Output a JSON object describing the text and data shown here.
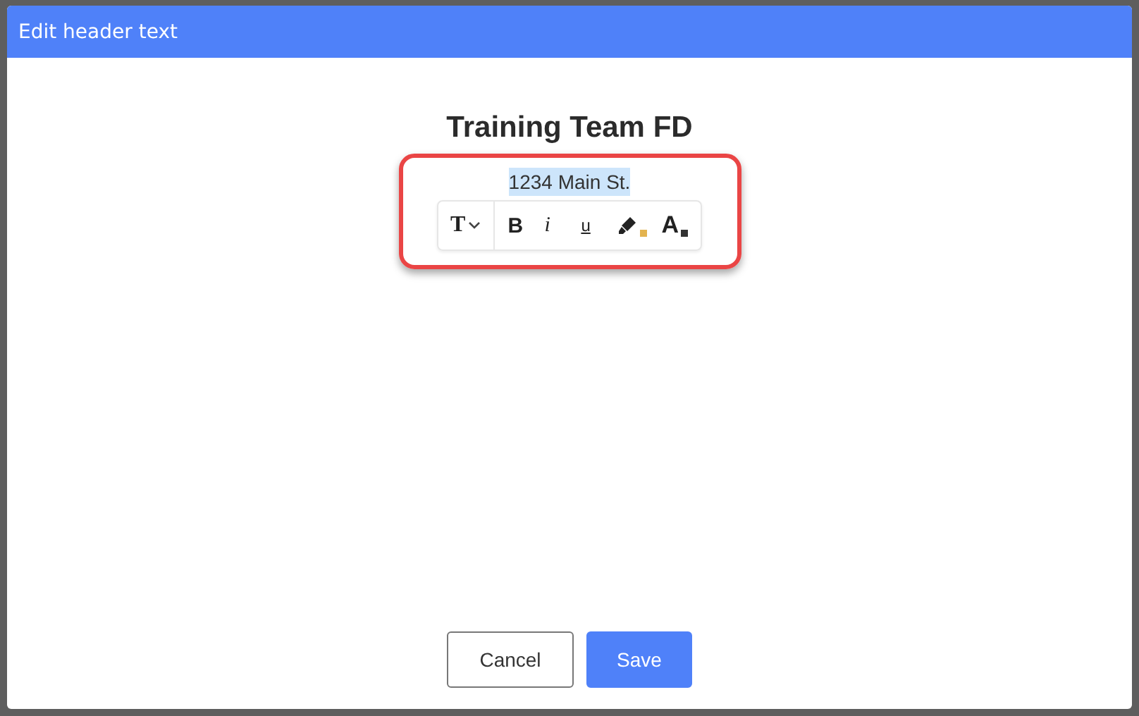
{
  "dialog": {
    "title": "Edit header text"
  },
  "header": {
    "heading": "Training Team FD",
    "address": {
      "text": "1234 Main St.",
      "selected": true
    }
  },
  "toolbar": [
    {
      "kind": "style",
      "label": "T"
    },
    {
      "kind": "bold",
      "label": "B"
    },
    {
      "kind": "italic",
      "label": "i"
    },
    {
      "kind": "underline",
      "label": "u"
    },
    {
      "kind": "highlight",
      "color": "#e3b34f"
    },
    {
      "kind": "fontcolor",
      "label": "A",
      "color": "#333333"
    }
  ],
  "buttons": [
    {
      "label": "Cancel",
      "kind": "secondary"
    },
    {
      "label": "Save",
      "kind": "primary"
    }
  ]
}
